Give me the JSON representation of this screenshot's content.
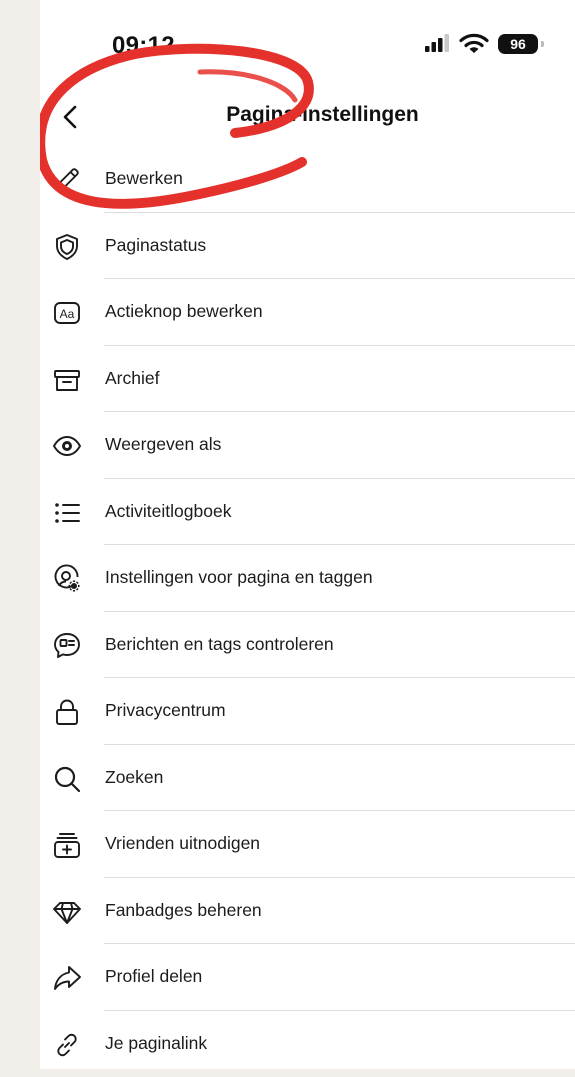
{
  "status_bar": {
    "time": "09:12",
    "battery": "96"
  },
  "header": {
    "title": "Pagina-instellingen"
  },
  "menu": [
    {
      "label": "Bewerken",
      "icon": "pencil-icon"
    },
    {
      "label": "Paginastatus",
      "icon": "shield-icon"
    },
    {
      "label": "Actieknop bewerken",
      "icon": "text-box-icon"
    },
    {
      "label": "Archief",
      "icon": "archive-box-icon"
    },
    {
      "label": "Weergeven als",
      "icon": "eye-icon"
    },
    {
      "label": "Activiteitlogboek",
      "icon": "list-icon"
    },
    {
      "label": "Instellingen voor pagina en taggen",
      "icon": "user-gear-icon"
    },
    {
      "label": "Berichten en tags controleren",
      "icon": "message-review-icon"
    },
    {
      "label": "Privacycentrum",
      "icon": "lock-icon"
    },
    {
      "label": "Zoeken",
      "icon": "search-icon"
    },
    {
      "label": "Vrienden uitnodigen",
      "icon": "invite-icon"
    },
    {
      "label": "Fanbadges beheren",
      "icon": "diamond-icon"
    },
    {
      "label": "Profiel delen",
      "icon": "share-icon"
    },
    {
      "label": "Je paginalink",
      "icon": "link-icon"
    }
  ],
  "annotation": {
    "color": "#e5312b",
    "target": "Bewerken"
  }
}
